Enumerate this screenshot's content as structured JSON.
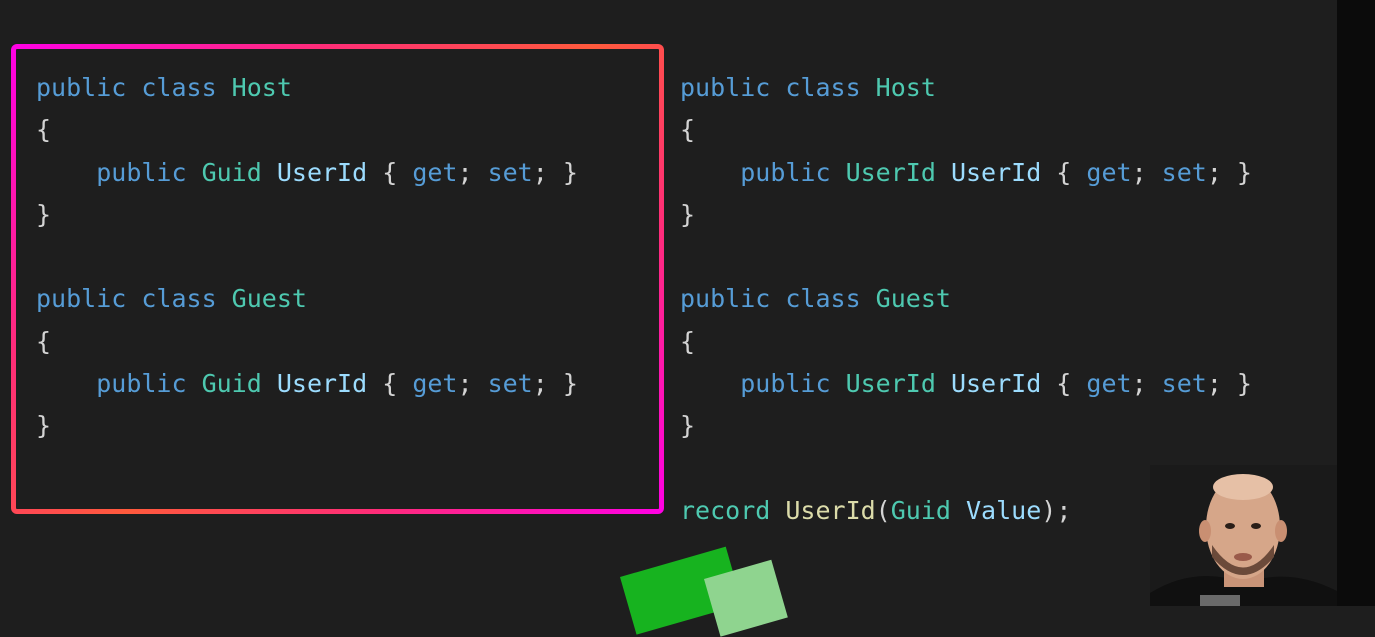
{
  "left_panel": {
    "lines": [
      [
        [
          "public ",
          "kw"
        ],
        [
          "class ",
          "kw"
        ],
        [
          "Host",
          "type"
        ]
      ],
      [
        [
          "{",
          "punct"
        ]
      ],
      [
        [
          "    ",
          "punct"
        ],
        [
          "public ",
          "kw"
        ],
        [
          "Guid ",
          "type"
        ],
        [
          "UserId ",
          "ident"
        ],
        [
          "{ ",
          "punct"
        ],
        [
          "get",
          "acc"
        ],
        [
          "; ",
          "punct"
        ],
        [
          "set",
          "acc"
        ],
        [
          "; }",
          "punct"
        ]
      ],
      [
        [
          "}",
          "punct"
        ]
      ],
      [],
      [
        [
          "public ",
          "kw"
        ],
        [
          "class ",
          "kw"
        ],
        [
          "Guest",
          "type"
        ]
      ],
      [
        [
          "{",
          "punct"
        ]
      ],
      [
        [
          "    ",
          "punct"
        ],
        [
          "public ",
          "kw"
        ],
        [
          "Guid ",
          "type"
        ],
        [
          "UserId ",
          "ident"
        ],
        [
          "{ ",
          "punct"
        ],
        [
          "get",
          "acc"
        ],
        [
          "; ",
          "punct"
        ],
        [
          "set",
          "acc"
        ],
        [
          "; }",
          "punct"
        ]
      ],
      [
        [
          "}",
          "punct"
        ]
      ]
    ]
  },
  "right_panel": {
    "lines": [
      [
        [
          "public ",
          "kw"
        ],
        [
          "class ",
          "kw"
        ],
        [
          "Host",
          "type"
        ]
      ],
      [
        [
          "{",
          "punct"
        ]
      ],
      [
        [
          "    ",
          "punct"
        ],
        [
          "public ",
          "kw"
        ],
        [
          "UserId ",
          "type"
        ],
        [
          "UserId ",
          "ident"
        ],
        [
          "{ ",
          "punct"
        ],
        [
          "get",
          "acc"
        ],
        [
          "; ",
          "punct"
        ],
        [
          "set",
          "acc"
        ],
        [
          "; }",
          "punct"
        ]
      ],
      [
        [
          "}",
          "punct"
        ]
      ],
      [],
      [
        [
          "public ",
          "kw"
        ],
        [
          "class ",
          "kw"
        ],
        [
          "Guest",
          "type"
        ]
      ],
      [
        [
          "{",
          "punct"
        ]
      ],
      [
        [
          "    ",
          "punct"
        ],
        [
          "public ",
          "kw"
        ],
        [
          "UserId ",
          "type"
        ],
        [
          "UserId ",
          "ident"
        ],
        [
          "{ ",
          "punct"
        ],
        [
          "get",
          "acc"
        ],
        [
          "; ",
          "punct"
        ],
        [
          "set",
          "acc"
        ],
        [
          "; }",
          "punct"
        ]
      ],
      [
        [
          "}",
          "punct"
        ]
      ],
      [],
      [
        [
          "record ",
          "record-kw"
        ],
        [
          "UserId",
          "record-name"
        ],
        [
          "(",
          "punct"
        ],
        [
          "Guid ",
          "type"
        ],
        [
          "Value",
          "param"
        ],
        [
          ");",
          "punct"
        ]
      ]
    ]
  },
  "colors": {
    "background": "#1e1e1e",
    "keyword": "#569cd6",
    "type": "#4ec9b0",
    "identifier": "#9cdcfe",
    "highlight_border": "#ff00e6"
  }
}
